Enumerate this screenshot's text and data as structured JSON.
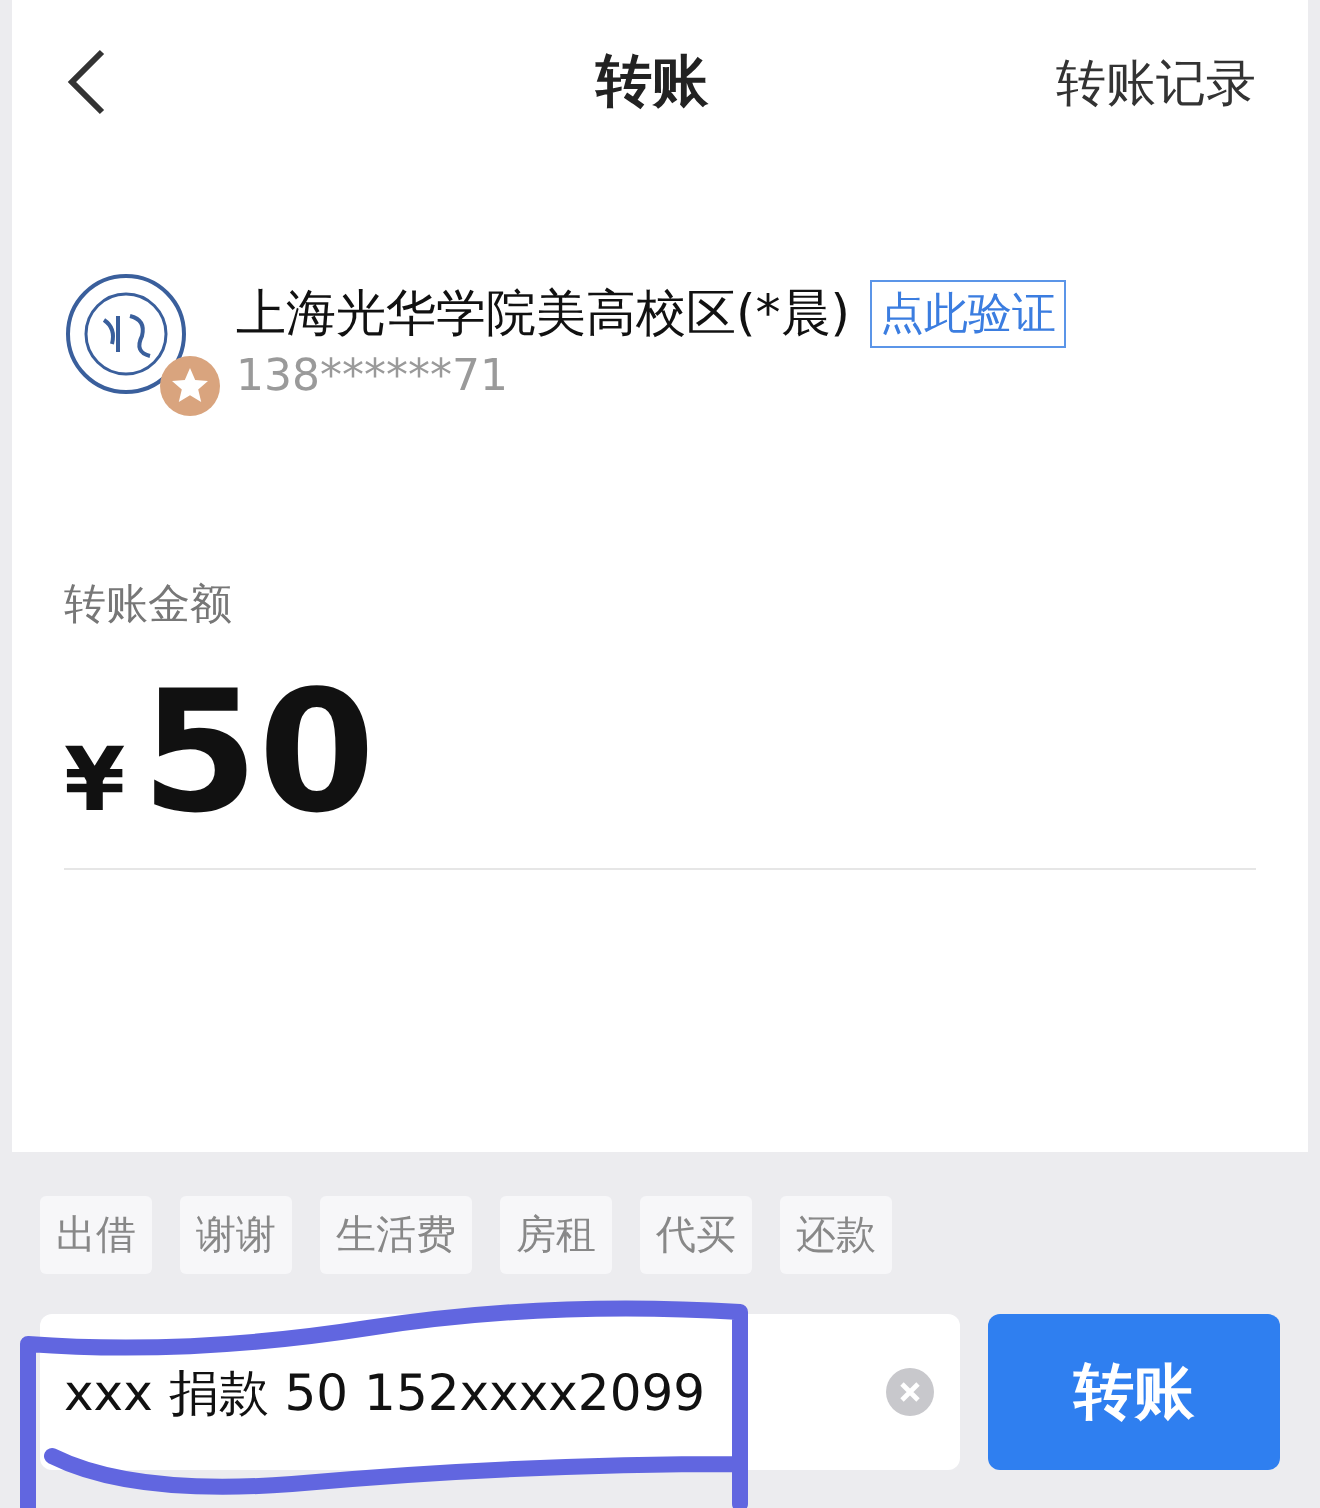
{
  "nav": {
    "title": "转账",
    "action": "转账记录"
  },
  "payee": {
    "name": "上海光华学院美高校区(*晨)",
    "verify_link": "点此验证",
    "phone": "138******71"
  },
  "amount": {
    "label": "转账金额",
    "currency": "¥",
    "value": "50"
  },
  "tags": [
    {
      "label": "出借"
    },
    {
      "label": "谢谢"
    },
    {
      "label": "生活费"
    },
    {
      "label": "房租"
    },
    {
      "label": "代买"
    },
    {
      "label": "还款"
    }
  ],
  "note": {
    "value": "xxx 捐款 50 152xxxx2099"
  },
  "submit": {
    "label": "转账"
  }
}
